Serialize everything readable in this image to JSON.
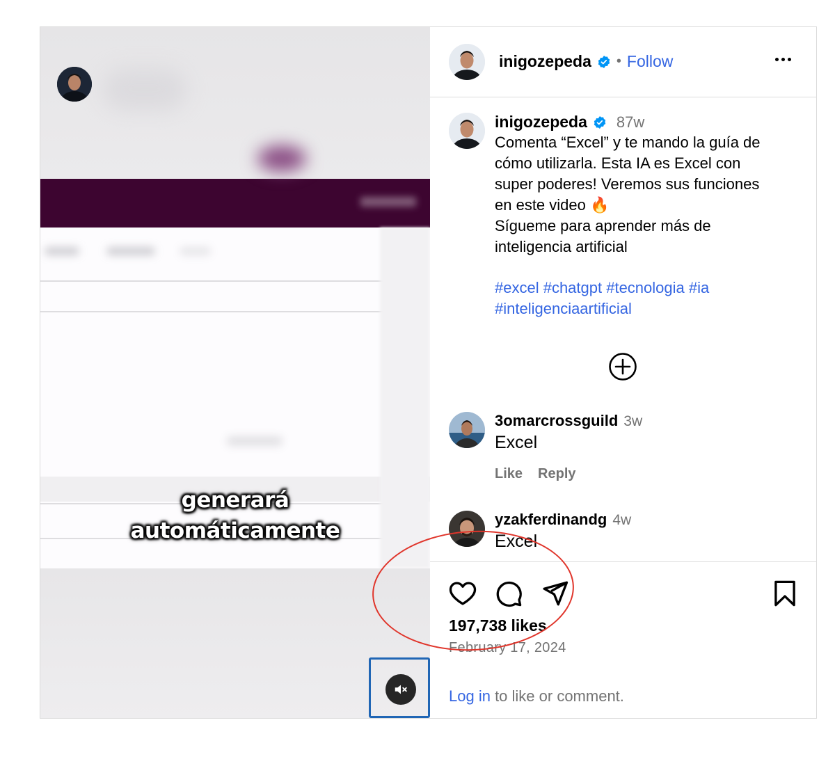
{
  "video": {
    "caption_line1": "generará",
    "caption_line2": "automáticamente",
    "mute_icon": "speaker-muted-icon"
  },
  "header": {
    "username": "inigozepeda",
    "separator": "•",
    "follow_label": "Follow",
    "more_icon": "more-options-icon"
  },
  "post_caption": {
    "username": "inigozepeda",
    "age": "87w",
    "lines": [
      "Comenta “Excel” y te mando la guía de",
      "cómo utilizarla. Esta IA es Excel con",
      "super poderes! Veremos sus funciones",
      "en este video 🔥",
      "Sígueme para aprender más de",
      "inteligencia artificial"
    ],
    "hashtags_line1": "#excel #chatgpt #tecnologia #ia",
    "hashtags_line2": "#inteligenciaartificial"
  },
  "comments": [
    {
      "username": "3omarcrossguild",
      "age": "3w",
      "text": "Excel",
      "like_label": "Like",
      "reply_label": "Reply"
    },
    {
      "username": "yzakferdinandg",
      "age": "4w",
      "text": "Excel"
    }
  ],
  "actions": {
    "likes": "197,738 likes",
    "date": "February 17, 2024",
    "login_link": "Log in",
    "login_rest": " to like or comment."
  },
  "colors": {
    "link_blue": "#3566e2",
    "verified_blue": "#0095f6",
    "annotation_red": "#e0352b",
    "video_header_purple": "#3d0530"
  }
}
